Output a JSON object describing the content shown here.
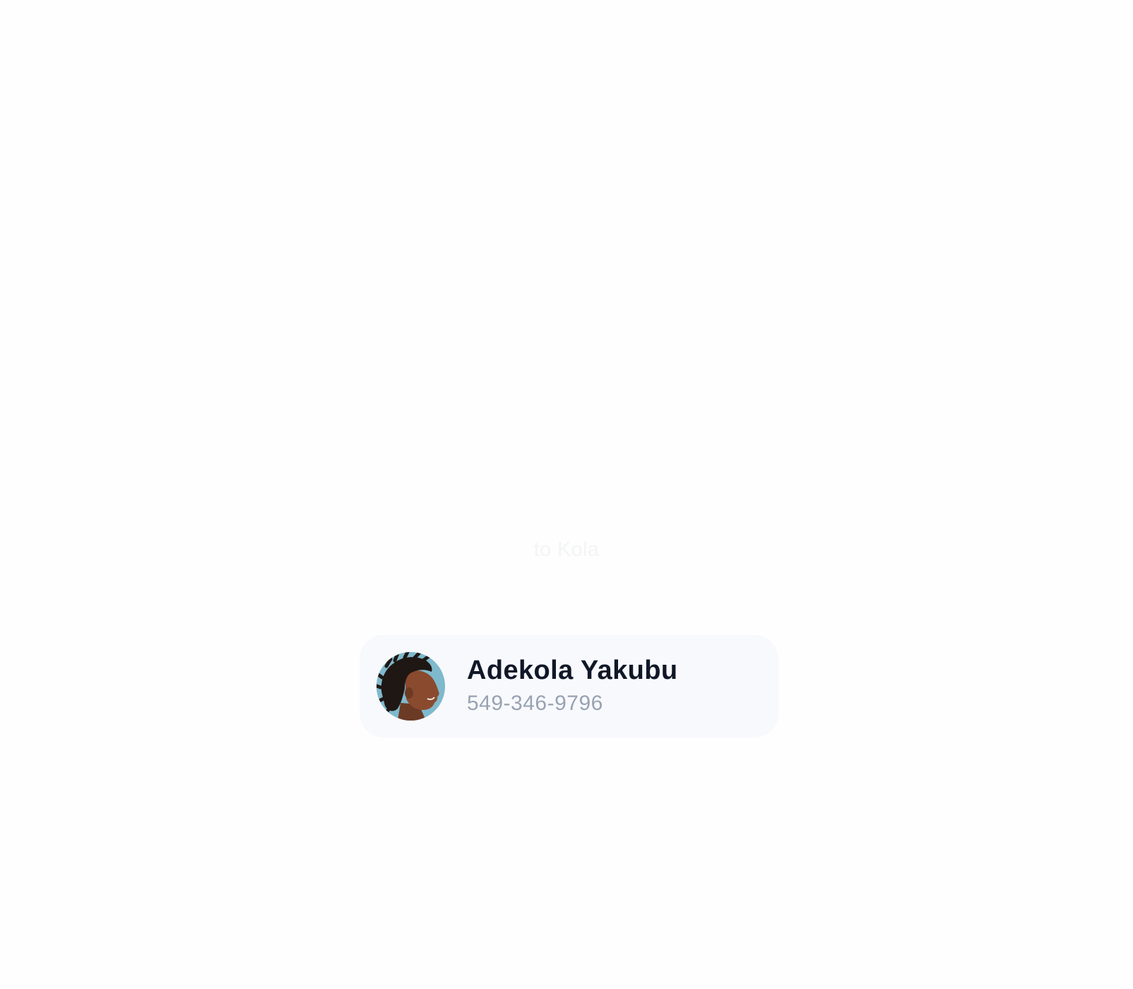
{
  "caption": "to Kola",
  "contact": {
    "name": "Adekola Yakubu",
    "phone": "549-346-9796",
    "avatar_icon": "person-photo-avatar"
  },
  "colors": {
    "background": "#fefefe",
    "card_background": "#f8f9fc",
    "name_text": "#101828",
    "phone_text": "#98a2b3",
    "avatar_background": "#7fb9cc"
  }
}
